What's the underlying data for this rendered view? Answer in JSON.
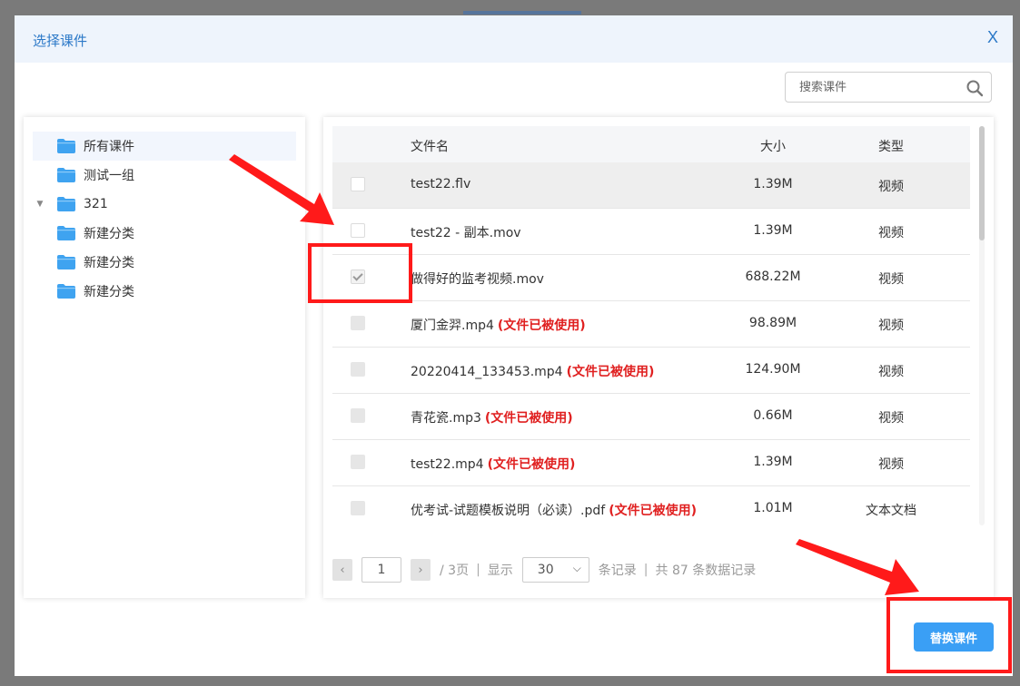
{
  "dialog": {
    "title": "选择课件",
    "close_label": "X"
  },
  "search": {
    "placeholder": "搜索课件",
    "icon": "search-icon"
  },
  "tree": {
    "items": [
      {
        "label": "所有课件",
        "active": true,
        "expandable": false
      },
      {
        "label": "测试一组",
        "active": false,
        "expandable": false
      },
      {
        "label": "321",
        "active": false,
        "expandable": true
      },
      {
        "label": "新建分类",
        "active": false,
        "expandable": false
      },
      {
        "label": "新建分类",
        "active": false,
        "expandable": false
      },
      {
        "label": "新建分类",
        "active": false,
        "expandable": false
      }
    ]
  },
  "table": {
    "headers": {
      "name": "文件名",
      "size": "大小",
      "type": "类型"
    },
    "used_tag": "(文件已被使用)",
    "rows": [
      {
        "name": "test22.flv",
        "size": "1.39M",
        "type": "视频",
        "state": "unchecked",
        "used": false
      },
      {
        "name": "test22 - 副本.mov",
        "size": "1.39M",
        "type": "视频",
        "state": "unchecked",
        "used": false
      },
      {
        "name": "做得好的监考视频.mov",
        "size": "688.22M",
        "type": "视频",
        "state": "checked",
        "used": false
      },
      {
        "name": "厦门金羿.mp4",
        "size": "98.89M",
        "type": "视频",
        "state": "disabled",
        "used": true
      },
      {
        "name": "20220414_133453.mp4",
        "size": "124.90M",
        "type": "视频",
        "state": "disabled",
        "used": true
      },
      {
        "name": "青花瓷.mp3",
        "size": "0.66M",
        "type": "视频",
        "state": "disabled",
        "used": true
      },
      {
        "name": "test22.mp4",
        "size": "1.39M",
        "type": "视频",
        "state": "disabled",
        "used": true
      },
      {
        "name": "优考试-试题模板说明（必读）.pdf",
        "size": "1.01M",
        "type": "文本文档",
        "state": "disabled",
        "used": true
      }
    ]
  },
  "pager": {
    "prev": "‹",
    "next": "›",
    "current_page": "1",
    "total_pages_text": "/ 3页",
    "show_label": "显示",
    "page_size": "30",
    "records_label": "条记录",
    "total_text": "共 87 条数据记录"
  },
  "actions": {
    "replace_label": "替换课件"
  },
  "colors": {
    "accent": "#3a9ff5",
    "title": "#2c79c8",
    "used_tag": "#e02020",
    "annotation": "#ff1a1a",
    "folder": "#3fa3f0"
  }
}
